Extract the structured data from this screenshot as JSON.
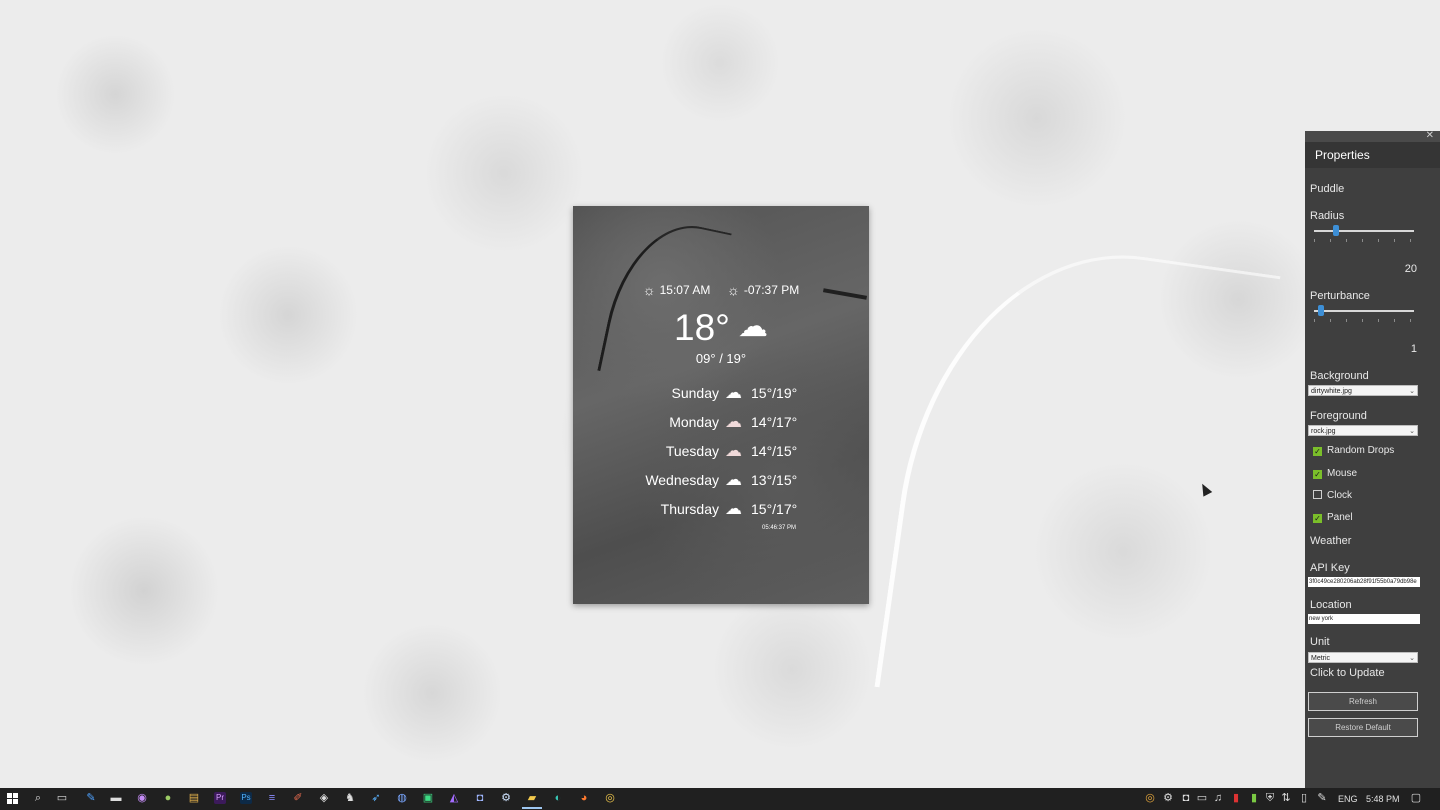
{
  "widget": {
    "sunrise_time": "15:07 AM",
    "sunset_time": "-07:37 PM",
    "current_temp": "18°",
    "min_max": "09° / 19°",
    "forecast": [
      {
        "day": "Sunday",
        "range": "15°/19°",
        "icon": "cloud-icon"
      },
      {
        "day": "Monday",
        "range": "14°/17°",
        "icon": "cloud-rain-icon"
      },
      {
        "day": "Tuesday",
        "range": "14°/15°",
        "icon": "cloud-rain-icon"
      },
      {
        "day": "Wednesday",
        "range": "13°/15°",
        "icon": "cloud-icon"
      },
      {
        "day": "Thursday",
        "range": "15°/17°",
        "icon": "cloud-icon"
      }
    ],
    "updated_time": "05:46:37 PM"
  },
  "properties": {
    "title": "Properties",
    "puddle_section": "Puddle",
    "radius_label": "Radius",
    "radius_value": "20",
    "radius_fraction": 0.2,
    "perturbance_label": "Perturbance",
    "perturbance_value": "1",
    "perturbance_fraction": 0.04,
    "background_label": "Background",
    "background_value": "dirtywhite.jpg",
    "foreground_label": "Foreground",
    "foreground_value": "rock.jpg",
    "checkboxes": [
      {
        "label": "Random Drops",
        "checked": true
      },
      {
        "label": "Mouse",
        "checked": true
      },
      {
        "label": "Clock",
        "checked": false
      },
      {
        "label": "Panel",
        "checked": true
      }
    ],
    "weather_section": "Weather",
    "api_key_label": "API Key",
    "api_key_value": "3f0c49ce280206ab28f91f55b0a79db98e",
    "location_label": "Location",
    "location_value": "new york",
    "unit_label": "Unit",
    "unit_value": "Metric",
    "click_to_update": "Click to Update",
    "refresh_label": "Refresh",
    "restore_label": "Restore Default"
  },
  "taskbar": {
    "language": "ENG",
    "time": "5:48 PM",
    "accent_color": "#9ec6f0"
  }
}
